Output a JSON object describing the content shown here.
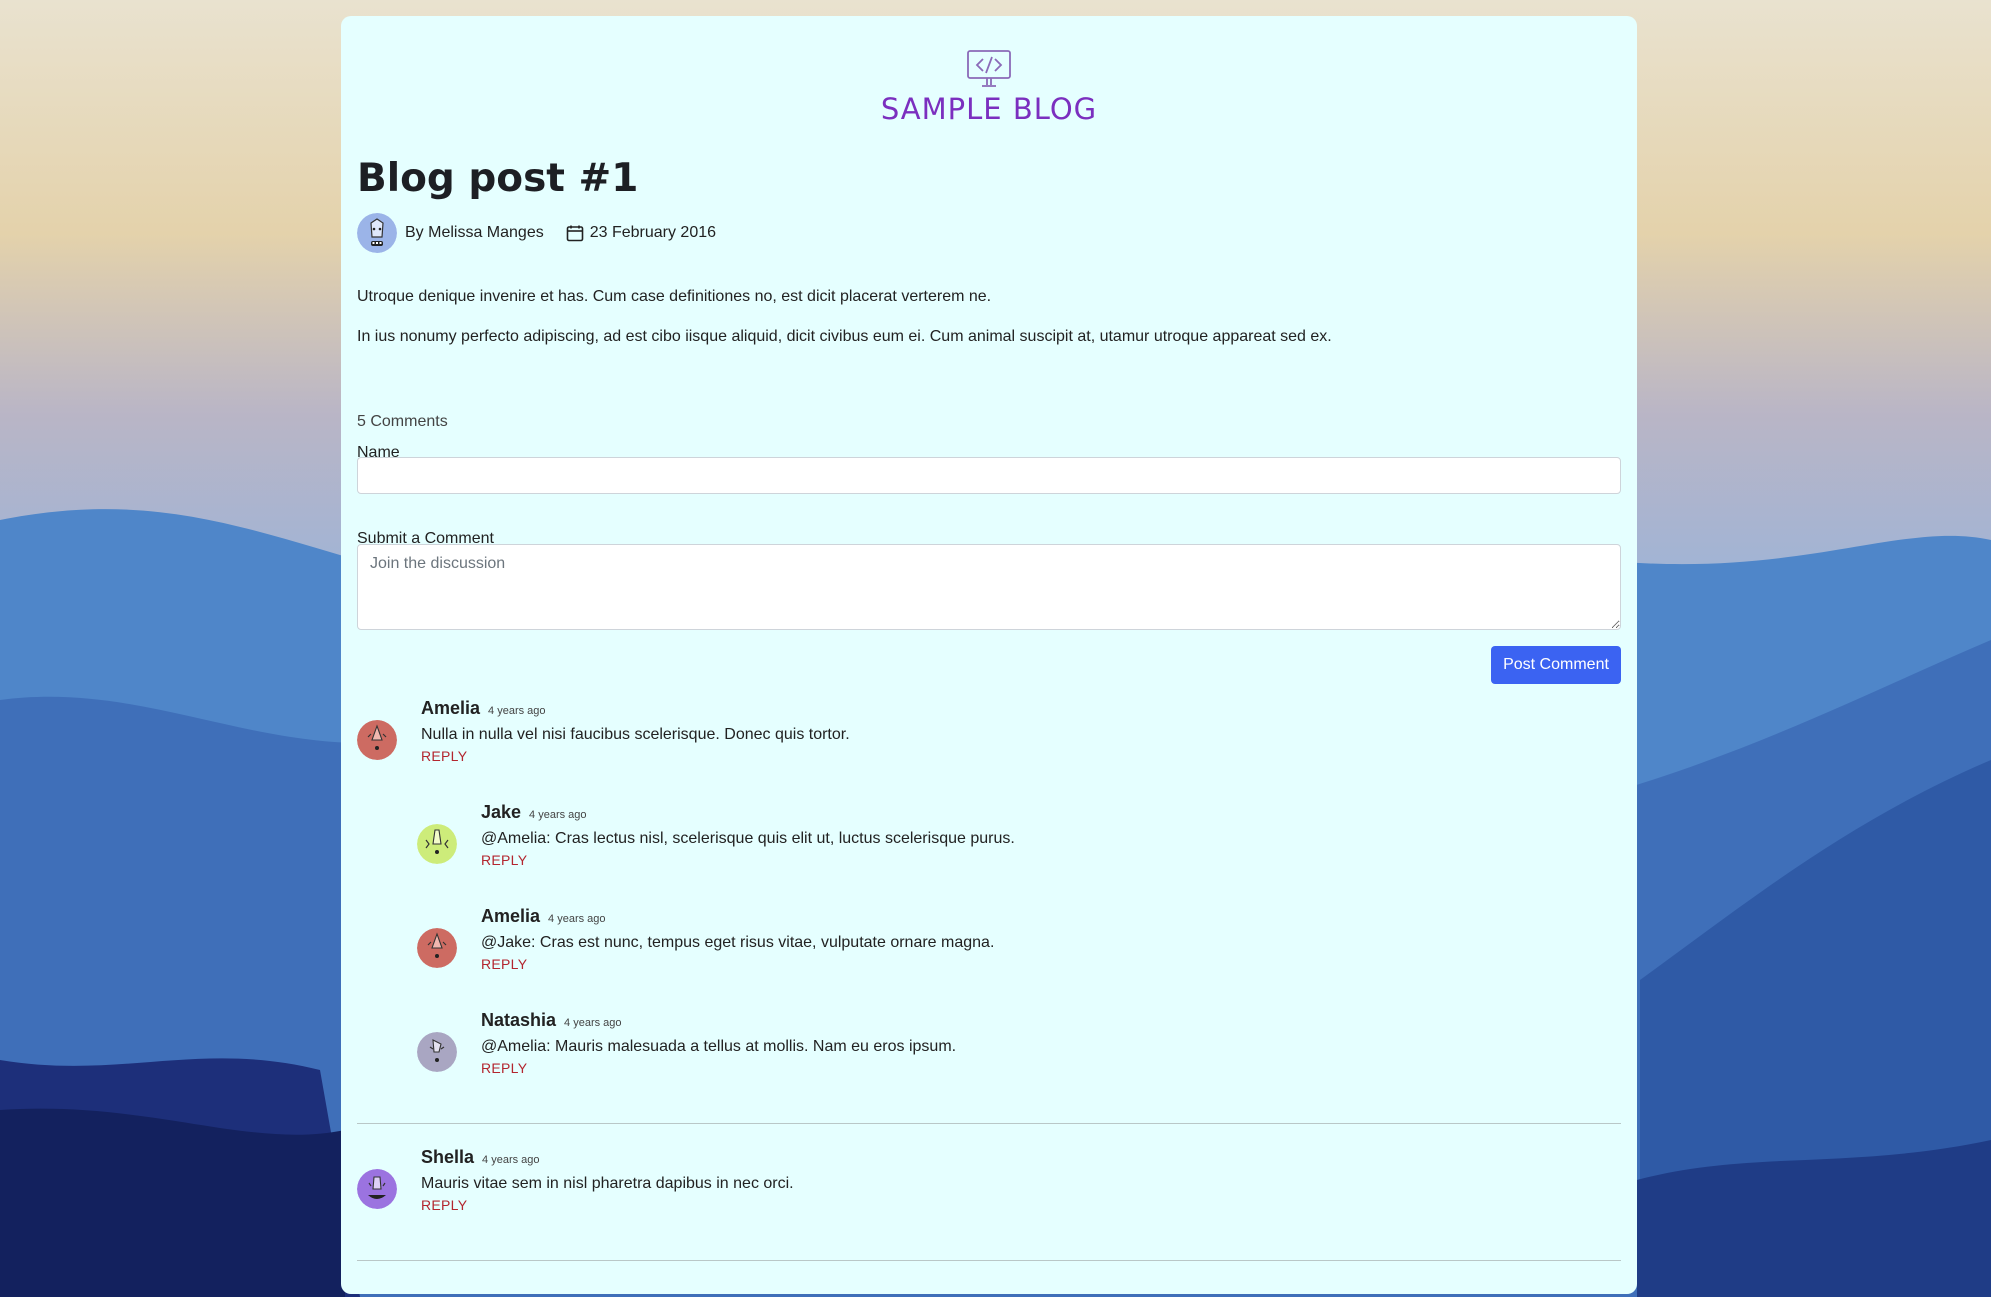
{
  "blog": {
    "title": "SAMPLE BLOG"
  },
  "post": {
    "title": "Blog post #1",
    "author": "By Melissa Manges",
    "date": "23 February 2016",
    "paragraphs": [
      "Utroque denique invenire et has. Cum case definitiones no, est dicit placerat verterem ne.",
      "In ius nonumy perfecto adipiscing, ad est cibo iisque aliquid, dicit civibus eum ei. Cum animal suscipit at, utamur utroque appareat sed ex."
    ]
  },
  "comments_section": {
    "count_label": "5 Comments",
    "name_label": "Name",
    "name_value": "",
    "comment_label": "Submit a Comment",
    "comment_placeholder": "Join the discussion",
    "post_button": "Post Comment",
    "reply_label": "REPLY"
  },
  "comments": [
    {
      "author": "Amelia",
      "time": "4 years ago",
      "text": "Nulla in nulla vel nisi faucibus scelerisque. Donec quis tortor.",
      "avatar_color": "#cd6b62"
    },
    {
      "author": "Jake",
      "time": "4 years ago",
      "text": "@Amelia: Cras lectus nisl, scelerisque quis elit ut, luctus scelerisque purus.",
      "avatar_color": "#cdec7a"
    },
    {
      "author": "Amelia",
      "time": "4 years ago",
      "text": "@Jake: Cras est nunc, tempus eget risus vitae, vulputate ornare magna.",
      "avatar_color": "#cd6b62"
    },
    {
      "author": "Natashia",
      "time": "4 years ago",
      "text": "@Amelia: Mauris malesuada a tellus at mollis. Nam eu eros ipsum.",
      "avatar_color": "#a9a6c2"
    },
    {
      "author": "Shella",
      "time": "4 years ago",
      "text": "Mauris vitae sem in nisl pharetra dapibus in nec orci.",
      "avatar_color": "#9b73e0"
    }
  ],
  "colors": {
    "card_bg": "#e5ffff",
    "brand": "#7b2fbf",
    "button": "#3b63f2",
    "reply": "#b3262f",
    "author_avatar": "#9bb4e8"
  },
  "icons": [
    "code-monitor-icon",
    "calendar-icon"
  ]
}
